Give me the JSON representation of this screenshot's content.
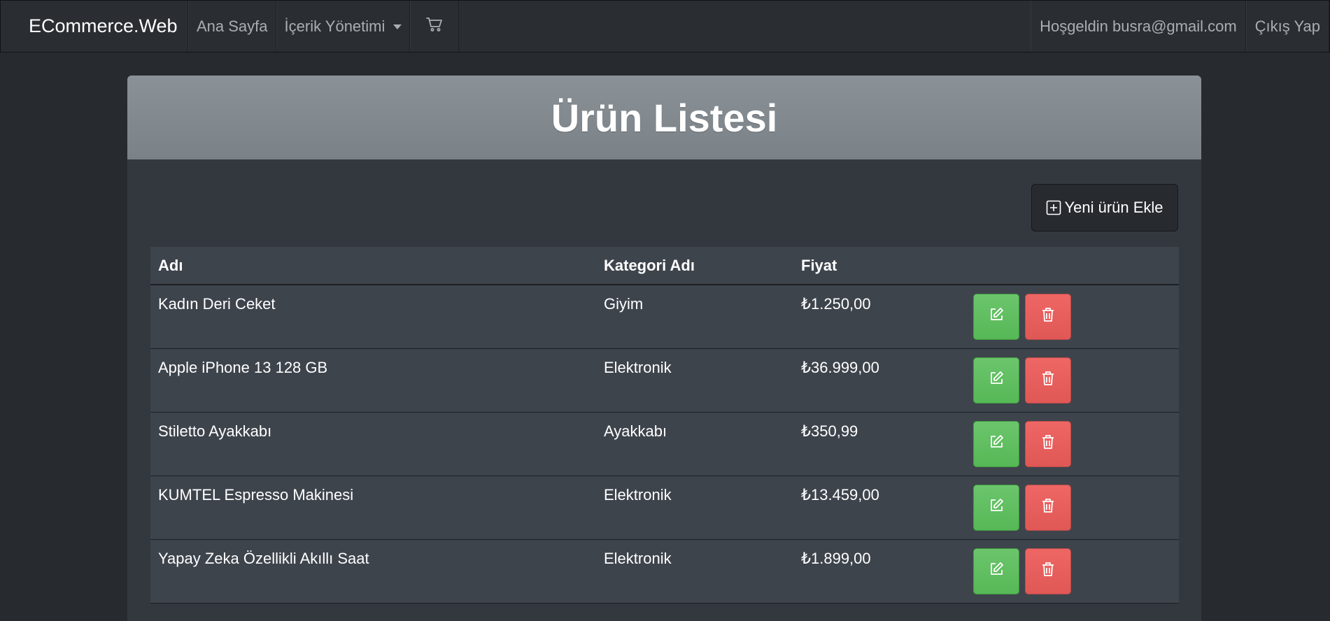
{
  "navbar": {
    "brand": "ECommerce.Web",
    "home": "Ana Sayfa",
    "content_menu": "İçerik Yönetimi",
    "cart_icon": "cart-icon",
    "greeting": "Hoşgeldin busra@gmail.com",
    "logout": "Çıkış Yap"
  },
  "page": {
    "title": "Ürün Listesi",
    "add_button": "Yeni ürün Ekle"
  },
  "table": {
    "headers": [
      "Adı",
      "Kategori Adı",
      "Fiyat"
    ],
    "rows": [
      {
        "name": "Kadın Deri Ceket",
        "category": "Giyim",
        "price": "₺1.250,00"
      },
      {
        "name": "Apple iPhone 13 128 GB",
        "category": "Elektronik",
        "price": "₺36.999,00"
      },
      {
        "name": "Stiletto Ayakkabı",
        "category": "Ayakkabı",
        "price": "₺350,99"
      },
      {
        "name": "KUMTEL Espresso Makinesi",
        "category": "Elektronik",
        "price": "₺13.459,00"
      },
      {
        "name": "Yapay Zeka Özellikli Akıllı Saat",
        "category": "Elektronik",
        "price": "₺1.899,00"
      }
    ]
  },
  "colors": {
    "edit_button": "#5cb85c",
    "delete_button": "#e86563",
    "header_band": "#7a8288"
  }
}
